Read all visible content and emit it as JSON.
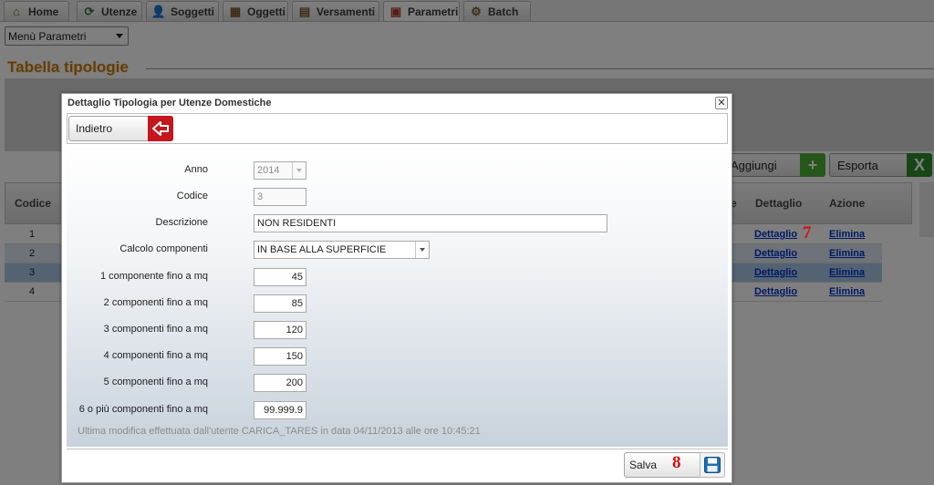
{
  "tabs": [
    {
      "label": "Home",
      "icon": "home-icon"
    },
    {
      "label": "Utenze",
      "icon": "cycle-icon"
    },
    {
      "label": "Soggetti",
      "icon": "person-icon"
    },
    {
      "label": "Oggetti",
      "icon": "building-icon"
    },
    {
      "label": "Versamenti",
      "icon": "payment-icon"
    },
    {
      "label": "Parametri",
      "icon": "params-icon"
    },
    {
      "label": "Batch",
      "icon": "gears-icon"
    }
  ],
  "active_tab": "Parametri",
  "menu_select": {
    "value": "Menù Parametri"
  },
  "page_title": "Tabella tipologie",
  "toolbar": {
    "add_label": "Aggiungi",
    "export_label": "Esporta"
  },
  "grid": {
    "headers": {
      "code": "Codice",
      "truncated": "e",
      "detail": "Dettaglio",
      "action": "Azione"
    },
    "rows": [
      {
        "code": "1",
        "detail": "Dettaglio",
        "action": "Elimina"
      },
      {
        "code": "2",
        "detail": "Dettaglio",
        "action": "Elimina"
      },
      {
        "code": "3",
        "detail": "Dettaglio",
        "action": "Elimina"
      },
      {
        "code": "4",
        "detail": "Dettaglio",
        "action": "Elimina"
      }
    ]
  },
  "markers": {
    "seven": "7",
    "eight": "8"
  },
  "dialog": {
    "title": "Dettaglio Tipologia per Utenze Domestiche",
    "close": "✕",
    "back_label": "Indietro",
    "fields": {
      "anno": {
        "label": "Anno",
        "value": "2014"
      },
      "codice": {
        "label": "Codice",
        "value": "3"
      },
      "descrizione": {
        "label": "Descrizione",
        "value": "NON RESIDENTI"
      },
      "calcolo": {
        "label": "Calcolo componenti",
        "value": "IN BASE ALLA SUPERFICIE"
      },
      "c1": {
        "label": "1 componente fino a mq",
        "value": "45"
      },
      "c2": {
        "label": "2 componenti fino a mq",
        "value": "85"
      },
      "c3": {
        "label": "3 componenti fino a mq",
        "value": "120"
      },
      "c4": {
        "label": "4 componenti fino a mq",
        "value": "150"
      },
      "c5": {
        "label": "5 componenti fino a mq",
        "value": "200"
      },
      "c6": {
        "label": "6 o più componenti fino a mq",
        "value": "99.999.9"
      }
    },
    "last_modified": "Ultima modifica effettuata dall'utente CARICA_TARES in data 04/11/2013 alle ore 10:45:21",
    "save_label": "Salva"
  },
  "colors": {
    "accent_title": "#c97b10",
    "back_red": "#c4161c",
    "add_green": "#4caf35",
    "export_green": "#2e8b2e",
    "link_blue": "#0033cc",
    "marker_red": "#d41010"
  }
}
